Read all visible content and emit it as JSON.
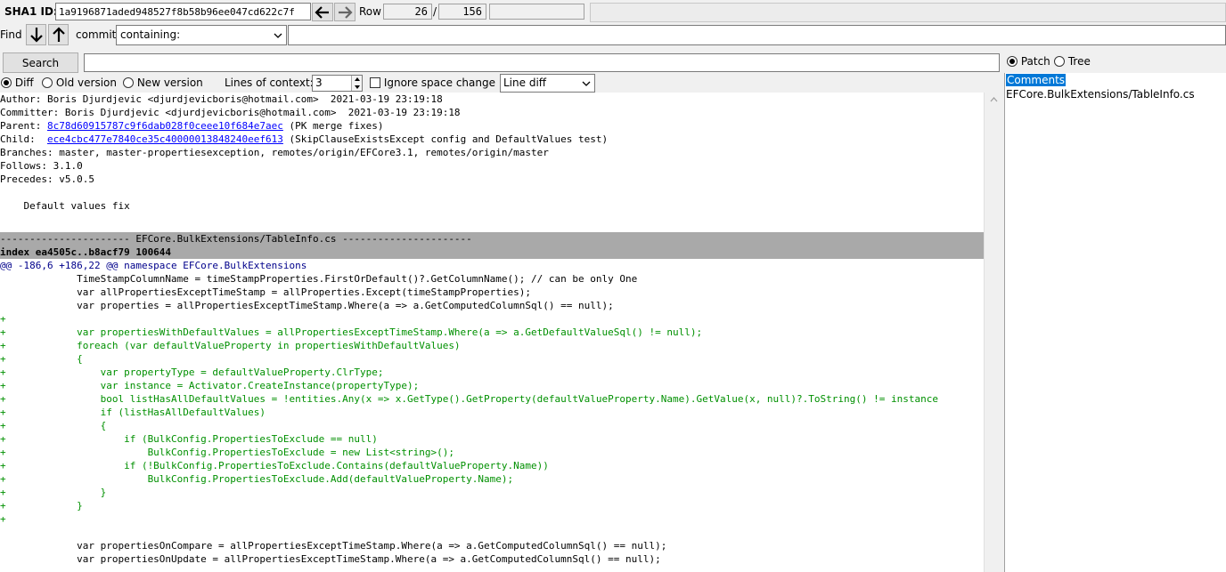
{
  "toolbar": {
    "sha1_label": "SHA1 ID:",
    "sha1_value": "1a9196871aded948527f8b58b96ee047cd622c7f",
    "row_label": "Row",
    "row_current": "26",
    "row_sep": "/",
    "row_total": "156"
  },
  "find": {
    "label": "Find",
    "type_label": "commit",
    "mode_value": "containing:",
    "query_value": ""
  },
  "search": {
    "button_label": "Search",
    "query_value": ""
  },
  "options": {
    "diff_label": "Diff",
    "old_version_label": "Old version",
    "new_version_label": "New version",
    "context_label": "Lines of context:",
    "context_value": "3",
    "ignore_space_label": "Ignore space change",
    "diff_mode_value": "Line diff"
  },
  "commit": {
    "author": "Author: Boris Djurdjevic <djurdjevicboris@hotmail.com>  2021-03-19 23:19:18",
    "committer": "Committer: Boris Djurdjevic <djurdjevicboris@hotmail.com>  2021-03-19 23:19:18",
    "parent_label": "Parent: ",
    "parent_hash": "8c78d60915787c9f6dab028f0ceee10f684e7aec",
    "parent_msg": " (PK merge fixes)",
    "child_label": "Child:  ",
    "child_hash": "ece4cbc477e7840ce35c40000013848240eef613",
    "child_msg": " (SkipClauseExistsExcept config and DefaultValues test)",
    "branches": "Branches: master, master-propertiesexception, remotes/origin/EFCore3.1, remotes/origin/master",
    "follows": "Follows: 3.1.0",
    "precedes": "Precedes: v5.0.5",
    "message": "    Default values fix"
  },
  "diff_lines": [
    {
      "t": "hdr",
      "s": "---------------------- EFCore.BulkExtensions/TableInfo.cs ----------------------"
    },
    {
      "t": "hdrb",
      "s": "index ea4505c..b8acf79 100644"
    },
    {
      "t": "hunk",
      "s": "@@ -186,6 +186,22 @@ namespace EFCore.BulkExtensions"
    },
    {
      "t": "ctx",
      "s": "             TimeStampColumnName = timeStampProperties.FirstOrDefault()?.GetColumnName(); // can be only One"
    },
    {
      "t": "ctx",
      "s": "             var allPropertiesExceptTimeStamp = allProperties.Except(timeStampProperties);"
    },
    {
      "t": "ctx",
      "s": "             var properties = allPropertiesExceptTimeStamp.Where(a => a.GetComputedColumnSql() == null);"
    },
    {
      "t": "add",
      "s": "+"
    },
    {
      "t": "add",
      "s": "+            var propertiesWithDefaultValues = allPropertiesExceptTimeStamp.Where(a => a.GetDefaultValueSql() != null);"
    },
    {
      "t": "add",
      "s": "+            foreach (var defaultValueProperty in propertiesWithDefaultValues)"
    },
    {
      "t": "add",
      "s": "+            {"
    },
    {
      "t": "add",
      "s": "+                var propertyType = defaultValueProperty.ClrType;"
    },
    {
      "t": "add",
      "s": "+                var instance = Activator.CreateInstance(propertyType);"
    },
    {
      "t": "add",
      "s": "+                bool listHasAllDefaultValues = !entities.Any(x => x.GetType().GetProperty(defaultValueProperty.Name).GetValue(x, null)?.ToString() != instance"
    },
    {
      "t": "add",
      "s": "+                if (listHasAllDefaultValues)"
    },
    {
      "t": "add",
      "s": "+                {"
    },
    {
      "t": "add",
      "s": "+                    if (BulkConfig.PropertiesToExclude == null)"
    },
    {
      "t": "add",
      "s": "+                        BulkConfig.PropertiesToExclude = new List<string>();"
    },
    {
      "t": "add",
      "s": "+                    if (!BulkConfig.PropertiesToExclude.Contains(defaultValueProperty.Name))"
    },
    {
      "t": "add",
      "s": "+                        BulkConfig.PropertiesToExclude.Add(defaultValueProperty.Name);"
    },
    {
      "t": "add",
      "s": "+                }"
    },
    {
      "t": "add",
      "s": "+            }"
    },
    {
      "t": "add",
      "s": "+"
    },
    {
      "t": "ctx",
      "s": " "
    },
    {
      "t": "ctx",
      "s": "             var propertiesOnCompare = allPropertiesExceptTimeStamp.Where(a => a.GetComputedColumnSql() == null);"
    },
    {
      "t": "ctx",
      "s": "             var propertiesOnUpdate = allPropertiesExceptTimeStamp.Where(a => a.GetComputedColumnSql() == null);"
    }
  ],
  "right": {
    "patch_label": "Patch",
    "tree_label": "Tree",
    "files": [
      "Comments",
      "EFCore.BulkExtensions/TableInfo.cs"
    ]
  }
}
